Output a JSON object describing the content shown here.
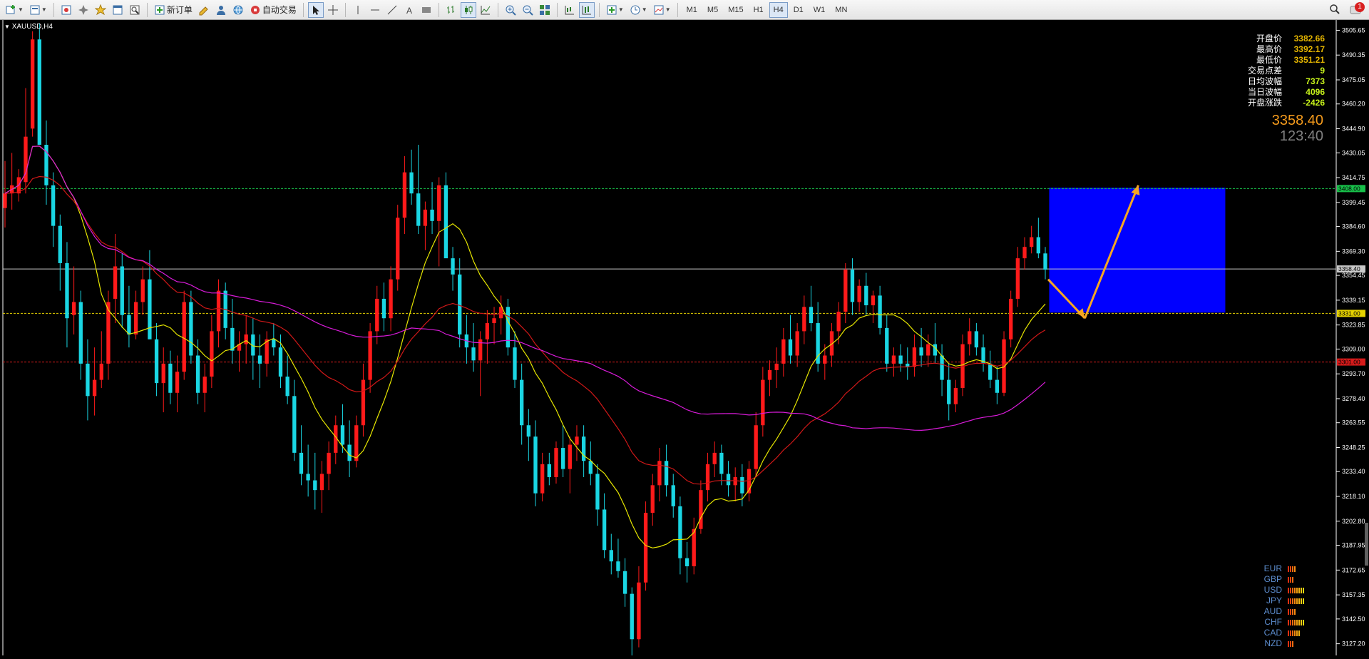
{
  "toolbar": {
    "new_order_label": "新订单",
    "auto_trade_label": "自动交易",
    "timeframes": [
      "M1",
      "M5",
      "M15",
      "H1",
      "H4",
      "D1",
      "W1",
      "MN"
    ],
    "active_timeframe": "H4",
    "notification_count": "1"
  },
  "chart": {
    "symbol_label": "XAUUSD,H4",
    "price_axis": {
      "min": 3120,
      "max": 3512,
      "ticks": [
        "3505.65",
        "3490.35",
        "3475.05",
        "3460.20",
        "3444.90",
        "3430.05",
        "3414.75",
        "3399.45",
        "3384.60",
        "3369.30",
        "3354.45",
        "3339.15",
        "3323.85",
        "3309.00",
        "3293.70",
        "3278.40",
        "3263.55",
        "3248.25",
        "3233.40",
        "3218.10",
        "3202.80",
        "3187.95",
        "3172.65",
        "3157.35",
        "3142.50",
        "3127.20"
      ]
    },
    "levels": [
      {
        "price": 3408.0,
        "label": "3408.00",
        "color": "#18c04a"
      },
      {
        "price": 3358.4,
        "label": "3358.40",
        "color": "#c8c8c8"
      },
      {
        "price": 3331.0,
        "label": "3331.00",
        "color": "#e6d200"
      },
      {
        "price": 3301.0,
        "label": "3301.00",
        "color": "#d81b1b"
      }
    ],
    "target_zone": {
      "price_top": 3408.5,
      "price_bottom": 3331.5,
      "color": "#0000ff"
    },
    "arrows": {
      "color": "#f5a623"
    },
    "colors": {
      "bull": "#ff1a1a",
      "bear": "#1ad6e3",
      "ma_fast": "#e6e600",
      "ma_mid": "#d01818",
      "ma_slow": "#d81bd8"
    },
    "candles": [
      [
        3396,
        3425,
        3384,
        3405
      ],
      [
        3405,
        3430,
        3395,
        3410
      ],
      [
        3405,
        3420,
        3400,
        3415
      ],
      [
        3412,
        3470,
        3405,
        3440
      ],
      [
        3445,
        3505,
        3440,
        3500
      ],
      [
        3500,
        3510,
        3448,
        3435
      ],
      [
        3435,
        3450,
        3398,
        3410
      ],
      [
        3410,
        3418,
        3372,
        3385
      ],
      [
        3385,
        3392,
        3345,
        3362
      ],
      [
        3362,
        3375,
        3310,
        3328
      ],
      [
        3330,
        3360,
        3318,
        3338
      ],
      [
        3338,
        3345,
        3290,
        3300
      ],
      [
        3300,
        3315,
        3265,
        3280
      ],
      [
        3280,
        3310,
        3268,
        3290
      ],
      [
        3290,
        3320,
        3285,
        3300
      ],
      [
        3300,
        3345,
        3290,
        3338
      ],
      [
        3340,
        3380,
        3325,
        3360
      ],
      [
        3360,
        3368,
        3322,
        3330
      ],
      [
        3330,
        3348,
        3310,
        3318
      ],
      [
        3318,
        3345,
        3315,
        3338
      ],
      [
        3338,
        3360,
        3330,
        3352
      ],
      [
        3352,
        3370,
        3320,
        3315
      ],
      [
        3315,
        3325,
        3280,
        3288
      ],
      [
        3288,
        3310,
        3270,
        3300
      ],
      [
        3300,
        3308,
        3275,
        3282
      ],
      [
        3282,
        3305,
        3270,
        3295
      ],
      [
        3295,
        3345,
        3290,
        3338
      ],
      [
        3338,
        3345,
        3300,
        3305
      ],
      [
        3305,
        3315,
        3275,
        3282
      ],
      [
        3282,
        3300,
        3270,
        3292
      ],
      [
        3292,
        3330,
        3285,
        3320
      ],
      [
        3320,
        3352,
        3310,
        3345
      ],
      [
        3345,
        3350,
        3315,
        3322
      ],
      [
        3322,
        3340,
        3300,
        3308
      ],
      [
        3308,
        3320,
        3295,
        3312
      ],
      [
        3312,
        3330,
        3300,
        3318
      ],
      [
        3318,
        3328,
        3290,
        3305
      ],
      [
        3305,
        3318,
        3285,
        3300
      ],
      [
        3300,
        3320,
        3292,
        3315
      ],
      [
        3315,
        3325,
        3305,
        3310
      ],
      [
        3310,
        3318,
        3285,
        3292
      ],
      [
        3292,
        3305,
        3275,
        3280
      ],
      [
        3280,
        3290,
        3240,
        3245
      ],
      [
        3245,
        3262,
        3225,
        3232
      ],
      [
        3232,
        3250,
        3218,
        3228
      ],
      [
        3228,
        3245,
        3210,
        3222
      ],
      [
        3222,
        3240,
        3208,
        3232
      ],
      [
        3232,
        3252,
        3222,
        3245
      ],
      [
        3245,
        3268,
        3238,
        3262
      ],
      [
        3262,
        3275,
        3245,
        3250
      ],
      [
        3250,
        3265,
        3230,
        3240
      ],
      [
        3240,
        3268,
        3236,
        3262
      ],
      [
        3262,
        3300,
        3255,
        3290
      ],
      [
        3290,
        3325,
        3282,
        3320
      ],
      [
        3320,
        3348,
        3312,
        3340
      ],
      [
        3340,
        3350,
        3320,
        3328
      ],
      [
        3328,
        3360,
        3320,
        3352
      ],
      [
        3352,
        3398,
        3345,
        3390
      ],
      [
        3390,
        3428,
        3380,
        3418
      ],
      [
        3418,
        3432,
        3398,
        3405
      ],
      [
        3405,
        3435,
        3380,
        3385
      ],
      [
        3385,
        3400,
        3370,
        3395
      ],
      [
        3395,
        3412,
        3380,
        3388
      ],
      [
        3388,
        3415,
        3360,
        3410
      ],
      [
        3410,
        3418,
        3370,
        3365
      ],
      [
        3365,
        3372,
        3345,
        3355
      ],
      [
        3355,
        3365,
        3310,
        3318
      ],
      [
        3318,
        3330,
        3300,
        3310
      ],
      [
        3310,
        3325,
        3295,
        3302
      ],
      [
        3302,
        3320,
        3280,
        3315
      ],
      [
        3315,
        3333,
        3300,
        3325
      ],
      [
        3325,
        3335,
        3312,
        3328
      ],
      [
        3328,
        3342,
        3318,
        3335
      ],
      [
        3335,
        3340,
        3305,
        3310
      ],
      [
        3310,
        3320,
        3285,
        3290
      ],
      [
        3290,
        3300,
        3250,
        3262
      ],
      [
        3262,
        3272,
        3240,
        3255
      ],
      [
        3255,
        3265,
        3212,
        3220
      ],
      [
        3220,
        3245,
        3215,
        3238
      ],
      [
        3238,
        3245,
        3225,
        3230
      ],
      [
        3230,
        3252,
        3226,
        3248
      ],
      [
        3248,
        3262,
        3230,
        3235
      ],
      [
        3235,
        3255,
        3220,
        3250
      ],
      [
        3250,
        3262,
        3240,
        3255
      ],
      [
        3255,
        3262,
        3230,
        3240
      ],
      [
        3240,
        3252,
        3225,
        3232
      ],
      [
        3232,
        3238,
        3200,
        3210
      ],
      [
        3210,
        3220,
        3180,
        3185
      ],
      [
        3185,
        3195,
        3170,
        3178
      ],
      [
        3178,
        3192,
        3168,
        3172
      ],
      [
        3172,
        3180,
        3150,
        3158
      ],
      [
        3158,
        3162,
        3120,
        3130
      ],
      [
        3130,
        3175,
        3125,
        3165
      ],
      [
        3165,
        3215,
        3160,
        3208
      ],
      [
        3208,
        3232,
        3200,
        3225
      ],
      [
        3225,
        3248,
        3215,
        3240
      ],
      [
        3240,
        3250,
        3218,
        3225
      ],
      [
        3225,
        3232,
        3205,
        3212
      ],
      [
        3212,
        3218,
        3170,
        3180
      ],
      [
        3180,
        3190,
        3165,
        3175
      ],
      [
        3175,
        3205,
        3170,
        3198
      ],
      [
        3198,
        3228,
        3195,
        3222
      ],
      [
        3222,
        3245,
        3215,
        3238
      ],
      [
        3238,
        3252,
        3230,
        3245
      ],
      [
        3245,
        3250,
        3225,
        3232
      ],
      [
        3232,
        3240,
        3218,
        3225
      ],
      [
        3225,
        3236,
        3215,
        3230
      ],
      [
        3230,
        3238,
        3212,
        3220
      ],
      [
        3220,
        3240,
        3215,
        3235
      ],
      [
        3235,
        3270,
        3230,
        3262
      ],
      [
        3262,
        3298,
        3255,
        3290
      ],
      [
        3290,
        3302,
        3280,
        3296
      ],
      [
        3296,
        3310,
        3285,
        3300
      ],
      [
        3300,
        3322,
        3292,
        3315
      ],
      [
        3315,
        3330,
        3300,
        3305
      ],
      [
        3305,
        3325,
        3298,
        3320
      ],
      [
        3320,
        3342,
        3312,
        3335
      ],
      [
        3335,
        3348,
        3320,
        3325
      ],
      [
        3325,
        3338,
        3295,
        3300
      ],
      [
        3300,
        3312,
        3290,
        3305
      ],
      [
        3305,
        3325,
        3298,
        3320
      ],
      [
        3320,
        3338,
        3312,
        3332
      ],
      [
        3332,
        3362,
        3325,
        3358
      ],
      [
        3358,
        3365,
        3330,
        3338
      ],
      [
        3338,
        3352,
        3332,
        3348
      ],
      [
        3348,
        3356,
        3330,
        3336
      ],
      [
        3336,
        3345,
        3325,
        3342
      ],
      [
        3342,
        3348,
        3318,
        3322
      ],
      [
        3322,
        3330,
        3295,
        3300
      ],
      [
        3300,
        3310,
        3292,
        3305
      ],
      [
        3305,
        3312,
        3295,
        3300
      ],
      [
        3300,
        3310,
        3290,
        3298
      ],
      [
        3298,
        3318,
        3292,
        3310
      ],
      [
        3310,
        3322,
        3298,
        3305
      ],
      [
        3305,
        3318,
        3298,
        3312
      ],
      [
        3312,
        3325,
        3300,
        3305
      ],
      [
        3305,
        3312,
        3280,
        3290
      ],
      [
        3290,
        3300,
        3265,
        3275
      ],
      [
        3275,
        3290,
        3270,
        3285
      ],
      [
        3285,
        3318,
        3280,
        3312
      ],
      [
        3312,
        3328,
        3305,
        3320
      ],
      [
        3320,
        3325,
        3305,
        3310
      ],
      [
        3310,
        3318,
        3295,
        3300
      ],
      [
        3300,
        3308,
        3285,
        3290
      ],
      [
        3290,
        3298,
        3275,
        3282
      ],
      [
        3282,
        3320,
        3280,
        3315
      ],
      [
        3315,
        3345,
        3310,
        3340
      ],
      [
        3340,
        3372,
        3335,
        3365
      ],
      [
        3365,
        3378,
        3358,
        3372
      ],
      [
        3372,
        3385,
        3368,
        3378
      ],
      [
        3378,
        3390,
        3365,
        3368
      ],
      [
        3368,
        3372,
        3352,
        3358
      ]
    ]
  },
  "ohlc_panel": {
    "rows": [
      {
        "label": "开盘价",
        "value": "3382.66"
      },
      {
        "label": "最高价",
        "value": "3392.17"
      },
      {
        "label": "最低价",
        "value": "3351.21"
      },
      {
        "label": "交易点差",
        "value": "9"
      },
      {
        "label": "日均波幅",
        "value": "7373"
      },
      {
        "label": "当日波幅",
        "value": "4096"
      },
      {
        "label": "开盘涨跌",
        "value": "-2426"
      }
    ],
    "current_price": "3358.40",
    "countdown": "123:40"
  },
  "currency_strength": [
    {
      "label": "EUR",
      "level": 4
    },
    {
      "label": "GBP",
      "level": 3
    },
    {
      "label": "USD",
      "level": 8
    },
    {
      "label": "JPY",
      "level": 8
    },
    {
      "label": "AUD",
      "level": 4
    },
    {
      "label": "CHF",
      "level": 8
    },
    {
      "label": "CAD",
      "level": 6
    },
    {
      "label": "NZD",
      "level": 3
    }
  ]
}
